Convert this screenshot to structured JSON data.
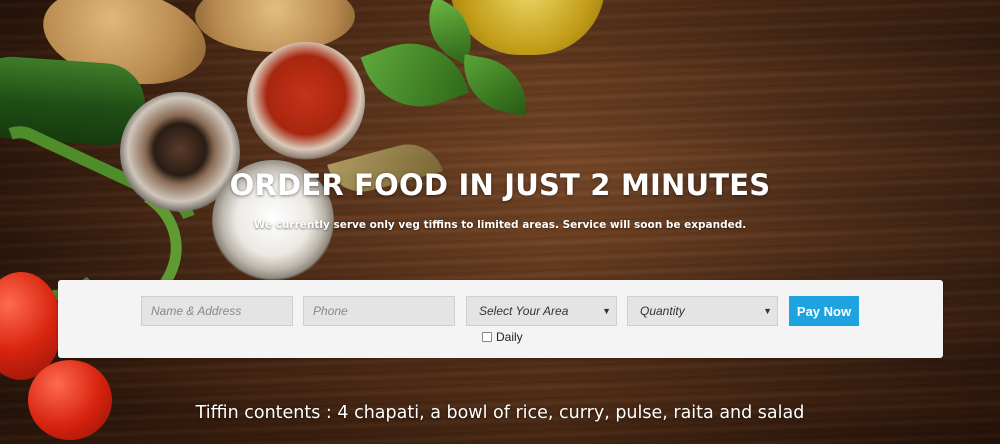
{
  "hero": {
    "headline": "ORDER FOOD IN JUST 2 MINUTES",
    "subline": "We currently serve only veg tiffins to limited areas. Service will soon be expanded."
  },
  "order_form": {
    "name_placeholder": "Name & Address",
    "phone_placeholder": "Phone",
    "area_selected": "Select Your Area",
    "quantity_selected": "Quantity",
    "pay_button_label": "Pay Now",
    "daily_label": "Daily",
    "daily_checked": false
  },
  "footer_note": "Tiffin contents : 4 chapati, a bowl of rice, curry, pulse, raita and salad",
  "colors": {
    "accent": "#1fa3e0",
    "panel": "#f4f4f4",
    "field": "#e4e4e4"
  },
  "icons": {
    "dropdown": "caret-down-icon"
  }
}
